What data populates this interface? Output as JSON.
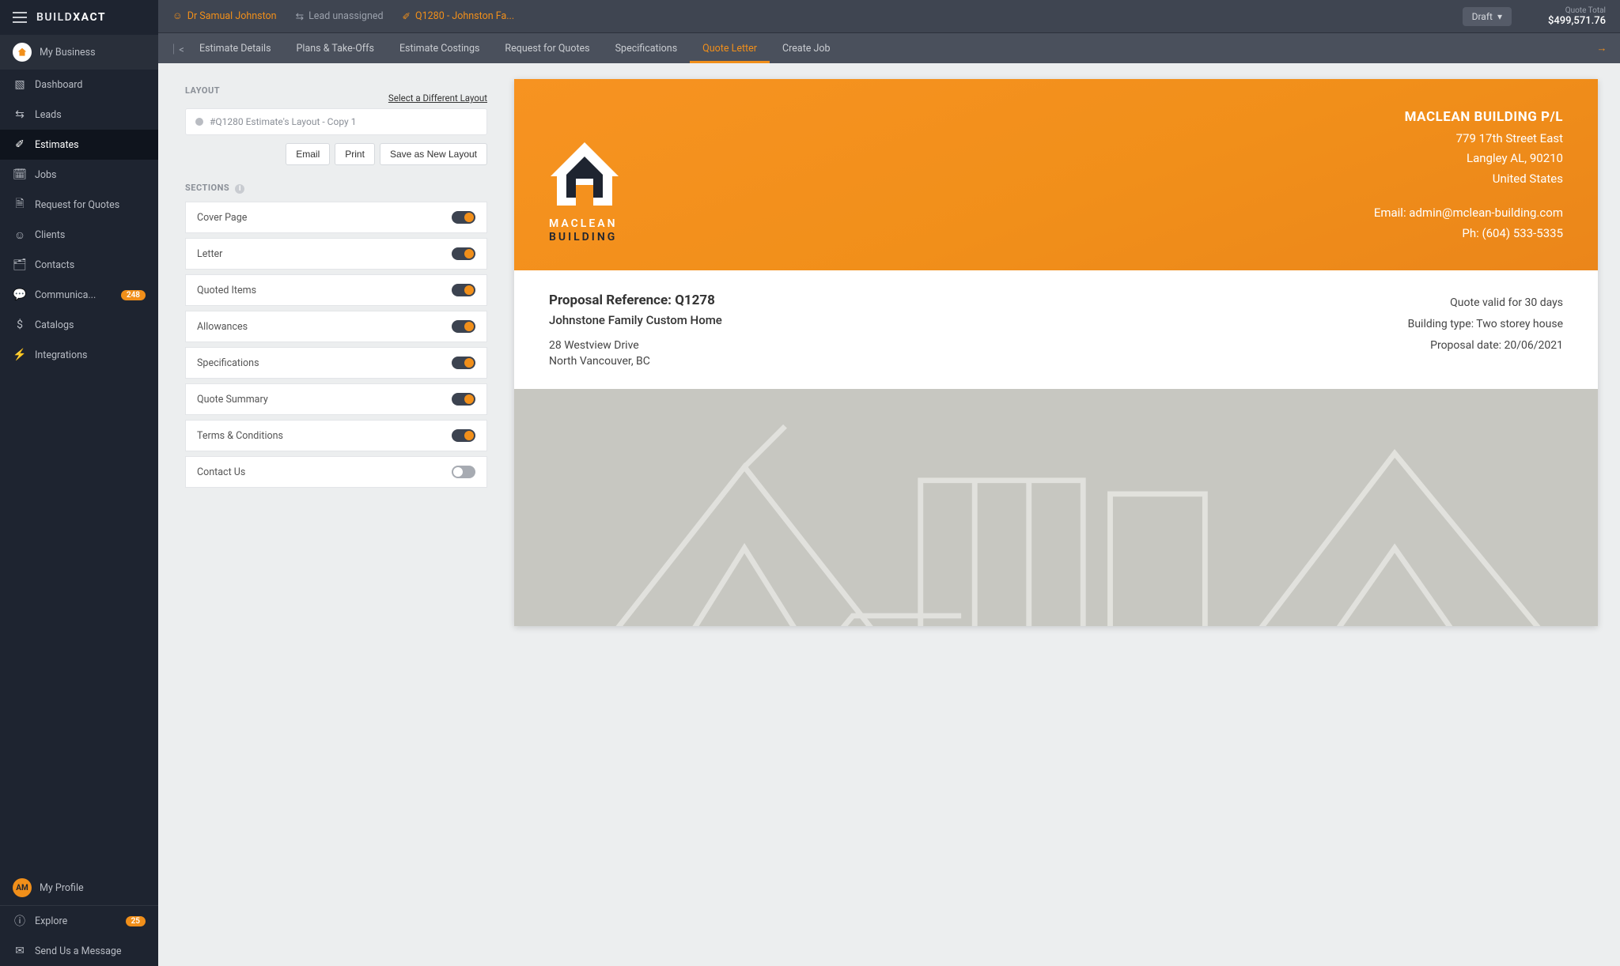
{
  "brand": {
    "b1": "BUILD",
    "b2": "XACT"
  },
  "sidebar": {
    "my_business": "My Business",
    "items": [
      {
        "label": "Dashboard"
      },
      {
        "label": "Leads"
      },
      {
        "label": "Estimates"
      },
      {
        "label": "Jobs"
      },
      {
        "label": "Request for Quotes"
      },
      {
        "label": "Clients"
      },
      {
        "label": "Contacts"
      },
      {
        "label": "Communica...",
        "badge": "248"
      },
      {
        "label": "Catalogs"
      },
      {
        "label": "Integrations"
      }
    ],
    "footer": {
      "profile_initials": "AM",
      "profile": "My Profile",
      "explore": "Explore",
      "explore_badge": "25",
      "message": "Send Us a Message"
    }
  },
  "topbar": {
    "client": "Dr Samual Johnston",
    "lead": "Lead unassigned",
    "estimate": "Q1280 - Johnston Fa...",
    "status": "Draft",
    "total_label": "Quote Total",
    "total_value": "$499,571.76"
  },
  "tabs": [
    "Estimate Details",
    "Plans & Take-Offs",
    "Estimate Costings",
    "Request for Quotes",
    "Specifications",
    "Quote Letter",
    "Create Job"
  ],
  "panel": {
    "layout_heading": "LAYOUT",
    "select_different": "Select a Different Layout",
    "layout_name": "#Q1280 Estimate's Layout - Copy 1",
    "actions": {
      "email": "Email",
      "print": "Print",
      "save": "Save as New Layout"
    },
    "sections_heading": "SECTIONS",
    "sections": [
      {
        "label": "Cover Page",
        "on": true
      },
      {
        "label": "Letter",
        "on": true
      },
      {
        "label": "Quoted Items",
        "on": true
      },
      {
        "label": "Allowances",
        "on": true
      },
      {
        "label": "Specifications",
        "on": true
      },
      {
        "label": "Quote Summary",
        "on": true
      },
      {
        "label": "Terms & Conditions",
        "on": true
      },
      {
        "label": "Contact Us",
        "on": false
      }
    ]
  },
  "doc": {
    "logo": {
      "line1": "MACLEAN",
      "line2": "BUILDING"
    },
    "company": {
      "name": "MACLEAN BUILDING P/L",
      "addr1": "779 17th Street East",
      "addr2": "Langley AL, 90210",
      "addr3": "United States",
      "email": "Email: admin@mclean-building.com",
      "phone": "Ph: (604) 533-5335"
    },
    "meta_left": {
      "ref": "Proposal Reference: Q1278",
      "project": "Johnstone Family Custom Home",
      "addr1": "28 Westview Drive",
      "addr2": "North Vancouver, BC"
    },
    "meta_right": {
      "valid": "Quote valid for 30 days",
      "type": "Building type: Two storey house",
      "date": "Proposal date: 20/06/2021"
    }
  }
}
